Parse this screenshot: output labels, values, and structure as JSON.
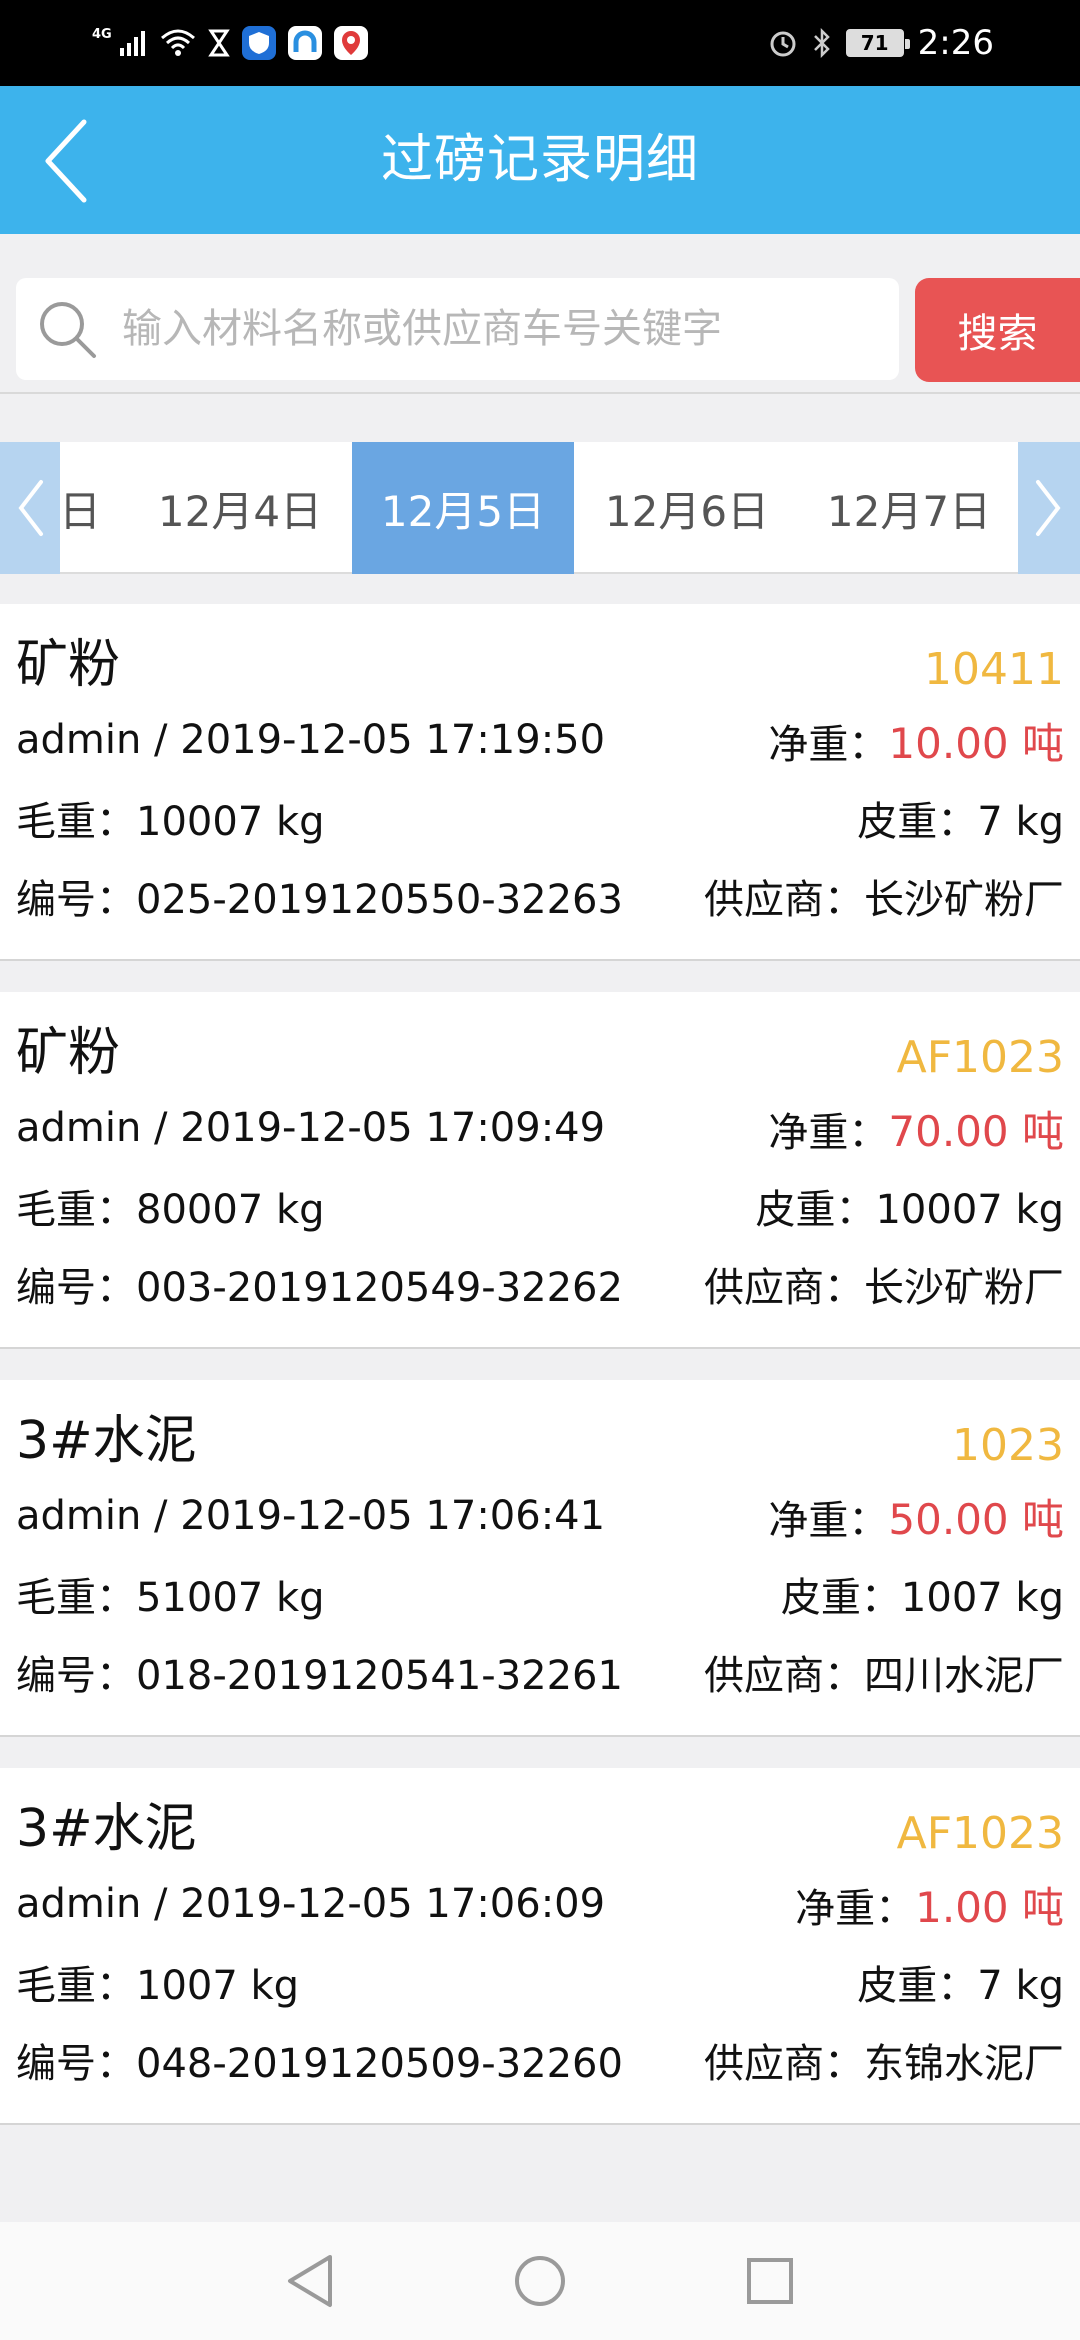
{
  "status_bar": {
    "network": "4G",
    "battery": "71",
    "time": "2:26"
  },
  "header": {
    "title": "过磅记录明细",
    "color": "#3db3ec"
  },
  "search": {
    "placeholder": "输入材料名称或供应商车号关键字",
    "button_label": "搜索",
    "button_color": "#e85454"
  },
  "dates": {
    "items": [
      "日",
      "12月4日",
      "12月5日",
      "12月6日",
      "12月7日"
    ],
    "selected": "12月5日"
  },
  "records": [
    {
      "material": "矿粉",
      "code": "10411",
      "operator_time": "admin / 2019-12-05 17:19:50",
      "net_label": "净重：",
      "net_value": "10.00 吨",
      "gross": "毛重：10007 kg",
      "tare": "皮重：7 kg",
      "serial": "编号：025-2019120550-32263",
      "supplier": "供应商：长沙矿粉厂"
    },
    {
      "material": "矿粉",
      "code": "AF1023",
      "operator_time": "admin / 2019-12-05 17:09:49",
      "net_label": "净重：",
      "net_value": "70.00 吨",
      "gross": "毛重：80007 kg",
      "tare": "皮重：10007 kg",
      "serial": "编号：003-2019120549-32262",
      "supplier": "供应商：长沙矿粉厂"
    },
    {
      "material": "3#水泥",
      "code": "1023",
      "operator_time": "admin / 2019-12-05 17:06:41",
      "net_label": "净重：",
      "net_value": "50.00 吨",
      "gross": "毛重：51007 kg",
      "tare": "皮重：1007 kg",
      "serial": "编号：018-2019120541-32261",
      "supplier": "供应商：四川水泥厂"
    },
    {
      "material": "3#水泥",
      "code": "AF1023",
      "operator_time": "admin / 2019-12-05 17:06:09",
      "net_label": "净重：",
      "net_value": "1.00 吨",
      "gross": "毛重：1007 kg",
      "tare": "皮重：7 kg",
      "serial": "编号：048-2019120509-32260",
      "supplier": "供应商：东锦水泥厂"
    }
  ],
  "colors": {
    "code": "#f0b840",
    "net_value": "#e0484c",
    "date_selected": "#6aa6e2"
  },
  "icons": {
    "back": "back-arrow-icon",
    "search": "search-icon",
    "prev": "chevron-left-icon",
    "next": "chevron-right-icon"
  }
}
